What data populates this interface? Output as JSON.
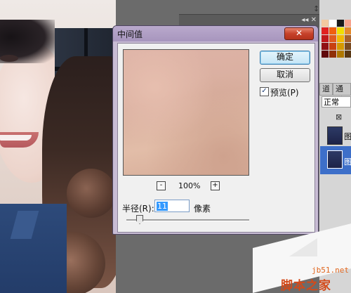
{
  "dialog": {
    "title": "中间值",
    "close_glyph": "✕",
    "ok_label": "确定",
    "cancel_label": "取消",
    "preview_checked": true,
    "preview_label": "预览(P)",
    "zoom_level": "100%",
    "zoom_out_glyph": "-",
    "zoom_in_glyph": "+",
    "radius_label": "半径(R):",
    "radius_value": "11",
    "radius_unit": "像素"
  },
  "panels": {
    "tab1": "道",
    "tab2": "通道",
    "blend_mode": "正常",
    "layer1_label": "图",
    "layer2_label": "图",
    "strip_controls": "◂◂ ✕"
  },
  "watermark": {
    "url": "jb51.net",
    "name": "脚本之家"
  },
  "colors": {
    "dialog_frame": "#c8bcd4",
    "title_gradient": "#b9a9cc",
    "close_red": "#c6412a",
    "default_button_blue": "#3c7fb1",
    "selection_blue": "#3399ff",
    "watermark_orange": "#d34a1a"
  }
}
